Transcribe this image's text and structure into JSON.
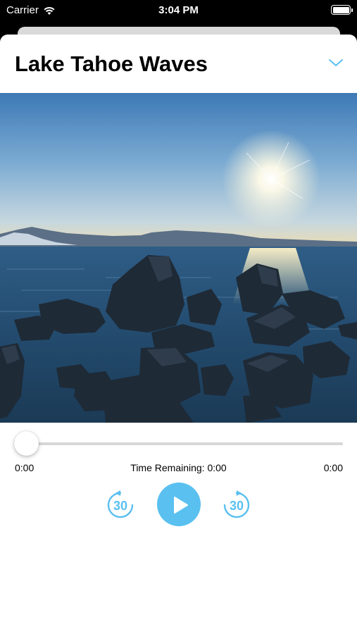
{
  "status_bar": {
    "carrier": "Carrier",
    "time": "3:04 PM"
  },
  "player": {
    "title": "Lake Tahoe Waves",
    "collapse_icon": "chevron-down-icon",
    "image_description_icon": "lake-photo",
    "progress_fraction": 0,
    "elapsed": "0:00",
    "remaining_label": "Time Remaining: 0:00",
    "duration": "0:00",
    "skip_back_label": "30",
    "skip_forward_label": "30",
    "play_icon": "play-icon"
  },
  "colors": {
    "accent": "#5ac0f0",
    "track": "#d7d7d9"
  }
}
